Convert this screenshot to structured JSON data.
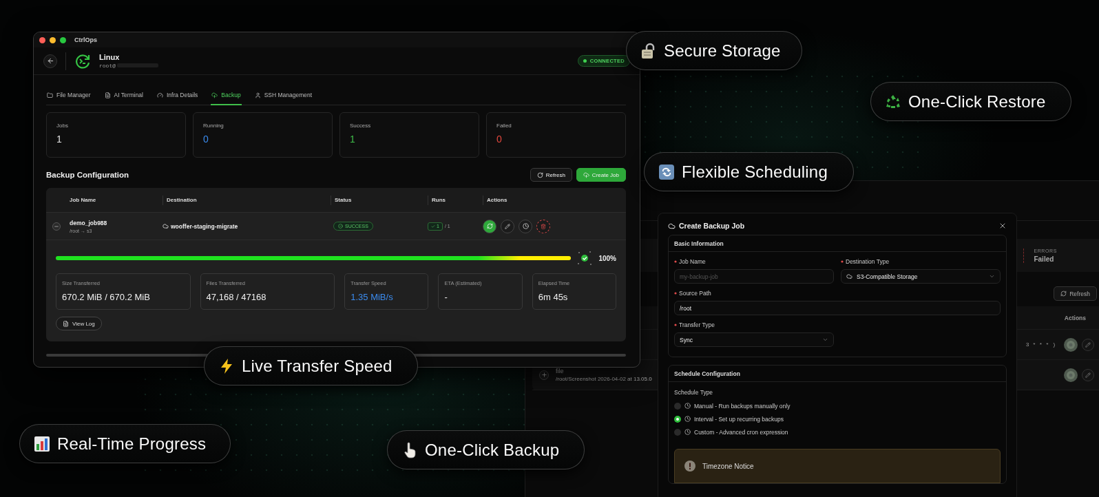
{
  "badges": [
    {
      "label": "Secure Storage"
    },
    {
      "label": "One-Click Restore"
    },
    {
      "label": "Flexible Scheduling"
    },
    {
      "label": "Live Transfer Speed"
    },
    {
      "label": "Real-Time Progress"
    },
    {
      "label": "One-Click Backup"
    }
  ],
  "main_window": {
    "title": "CtrlOps",
    "host": "Linux",
    "user": "root@",
    "connection": "CONNECTED",
    "tabs": [
      {
        "label": "File Manager",
        "selected": false
      },
      {
        "label": "AI Terminal",
        "selected": false
      },
      {
        "label": "Infra Details",
        "selected": false
      },
      {
        "label": "Backup",
        "selected": true
      },
      {
        "label": "SSH Management",
        "selected": false
      }
    ],
    "stats": [
      {
        "label": "Jobs",
        "value": "1",
        "color": "#e6e6e6"
      },
      {
        "label": "Running",
        "value": "0",
        "color": "#3b8cf0"
      },
      {
        "label": "Success",
        "value": "1",
        "color": "#3fbf4a"
      },
      {
        "label": "Failed",
        "value": "0",
        "color": "#e5483e"
      }
    ],
    "section_title": "Backup Configuration",
    "buttons": [
      {
        "label": "Refresh",
        "kind": "secondary"
      },
      {
        "label": "Create Job",
        "kind": "primary"
      }
    ],
    "table": {
      "columns": [
        "Job Name",
        "Destination",
        "Status",
        "Runs",
        "Actions"
      ],
      "rows": [
        {
          "name": "demo_job988",
          "path": "/root → s3",
          "destination": "wooffer-staging-migrate",
          "status": "SUCCESS",
          "runs_ok": "1",
          "runs_total": "/ 1",
          "expanded": true,
          "progress": {
            "level": 1,
            "percent": "100%"
          },
          "metrics": [
            {
              "label": "Size Transferred",
              "value": "670.2 MiB / 670.2 MiB",
              "accent": false
            },
            {
              "label": "Files Transferred",
              "value": "47,168 / 47168",
              "accent": false
            },
            {
              "label": "Transfer Speed",
              "value": "1.35 MiB/s",
              "accent": true
            },
            {
              "label": "ETA (Estimated)",
              "value": "-",
              "accent": false
            },
            {
              "label": "Elapsed Time",
              "value": "6m 45s",
              "accent": false
            }
          ],
          "view_log": "View Log"
        }
      ]
    }
  },
  "back_window": {
    "stat_label": "ERRORS",
    "stat_value": "Failed",
    "refresh": "Refresh",
    "actions_column": "Actions",
    "rows": [
      {
        "schedule": "3 * * * )"
      },
      {
        "name": "file",
        "path": "/root/Screenshot 2026-04-02 at 13.05.0",
        "expanded": false
      }
    ]
  },
  "dialog": {
    "title": "Create Backup Job",
    "basic": {
      "title": "Basic Information",
      "fields": [
        {
          "label": "Job Name",
          "required": true,
          "kind": "input",
          "placeholder": "my-backup-job"
        },
        {
          "label": "Destination Type",
          "required": true,
          "kind": "select",
          "value": "S3-Compatible Storage"
        },
        {
          "label": "Source Path",
          "required": true,
          "kind": "input",
          "value": "/root"
        },
        {
          "label": "Transfer Type",
          "required": true,
          "kind": "select",
          "value": "Sync"
        }
      ]
    },
    "schedule": {
      "title": "Schedule Configuration",
      "label": "Schedule Type",
      "options": [
        {
          "label": "Manual - Run backups manually only",
          "selected": false
        },
        {
          "label": "Interval - Set up recurring backups",
          "selected": true
        },
        {
          "label": "Custom - Advanced cron expression",
          "selected": false
        }
      ],
      "notice": "Timezone Notice"
    }
  }
}
